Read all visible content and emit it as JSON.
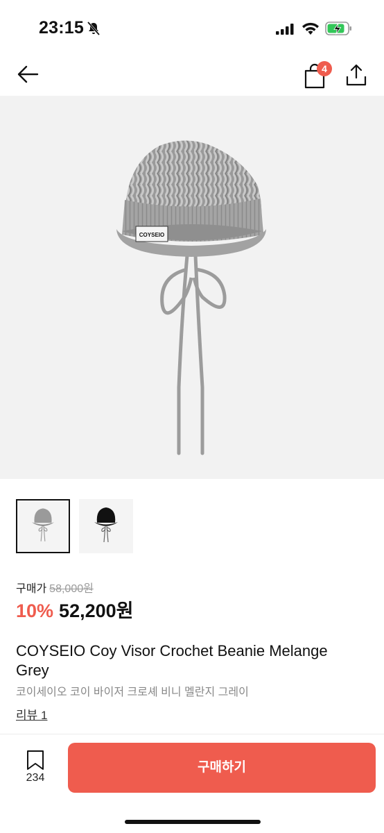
{
  "status_bar": {
    "time": "23:15",
    "icons": [
      "bell-slash-icon",
      "signal-icon",
      "wifi-icon",
      "battery-charging-icon"
    ]
  },
  "nav": {
    "back_icon": "arrow-left-icon",
    "cart_icon": "shopping-bag-icon",
    "cart_count": "4",
    "share_icon": "share-icon"
  },
  "gallery": {
    "images": [
      {
        "name": "grey-beanie",
        "selected": true
      },
      {
        "name": "black-beanie",
        "selected": false
      }
    ],
    "hat_label": "COYSEIO"
  },
  "price": {
    "label": "구매가",
    "original": "58,000원",
    "discount": "10%",
    "sale": "52,200원"
  },
  "product": {
    "title": "COYSEIO Coy Visor Crochet Beanie Melange Grey",
    "subtitle": "코이세이오 코이 바이저 크로셰 비니 멜란지 그레이",
    "review_link": "리뷰 1"
  },
  "bottom_bar": {
    "bookmark_count": "234",
    "buy_label": "구매하기"
  },
  "colors": {
    "accent": "#ef5c4e",
    "hero_bg": "#f2f2f2",
    "muted_text": "#888888"
  }
}
